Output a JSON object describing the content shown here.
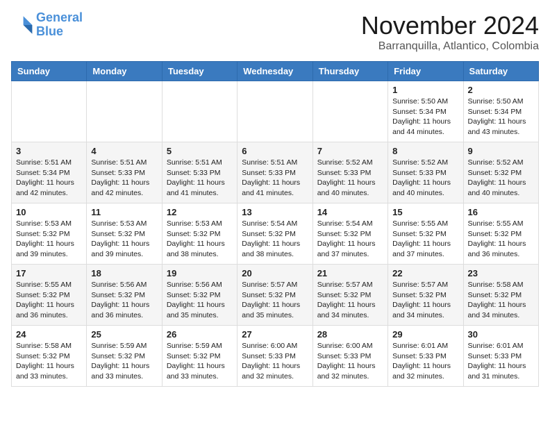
{
  "logo": {
    "line1": "General",
    "line2": "Blue"
  },
  "title": "November 2024",
  "location": "Barranquilla, Atlantico, Colombia",
  "days_of_week": [
    "Sunday",
    "Monday",
    "Tuesday",
    "Wednesday",
    "Thursday",
    "Friday",
    "Saturday"
  ],
  "weeks": [
    [
      {
        "day": "",
        "info": ""
      },
      {
        "day": "",
        "info": ""
      },
      {
        "day": "",
        "info": ""
      },
      {
        "day": "",
        "info": ""
      },
      {
        "day": "",
        "info": ""
      },
      {
        "day": "1",
        "info": "Sunrise: 5:50 AM\nSunset: 5:34 PM\nDaylight: 11 hours\nand 44 minutes."
      },
      {
        "day": "2",
        "info": "Sunrise: 5:50 AM\nSunset: 5:34 PM\nDaylight: 11 hours\nand 43 minutes."
      }
    ],
    [
      {
        "day": "3",
        "info": "Sunrise: 5:51 AM\nSunset: 5:34 PM\nDaylight: 11 hours\nand 42 minutes."
      },
      {
        "day": "4",
        "info": "Sunrise: 5:51 AM\nSunset: 5:33 PM\nDaylight: 11 hours\nand 42 minutes."
      },
      {
        "day": "5",
        "info": "Sunrise: 5:51 AM\nSunset: 5:33 PM\nDaylight: 11 hours\nand 41 minutes."
      },
      {
        "day": "6",
        "info": "Sunrise: 5:51 AM\nSunset: 5:33 PM\nDaylight: 11 hours\nand 41 minutes."
      },
      {
        "day": "7",
        "info": "Sunrise: 5:52 AM\nSunset: 5:33 PM\nDaylight: 11 hours\nand 40 minutes."
      },
      {
        "day": "8",
        "info": "Sunrise: 5:52 AM\nSunset: 5:33 PM\nDaylight: 11 hours\nand 40 minutes."
      },
      {
        "day": "9",
        "info": "Sunrise: 5:52 AM\nSunset: 5:32 PM\nDaylight: 11 hours\nand 40 minutes."
      }
    ],
    [
      {
        "day": "10",
        "info": "Sunrise: 5:53 AM\nSunset: 5:32 PM\nDaylight: 11 hours\nand 39 minutes."
      },
      {
        "day": "11",
        "info": "Sunrise: 5:53 AM\nSunset: 5:32 PM\nDaylight: 11 hours\nand 39 minutes."
      },
      {
        "day": "12",
        "info": "Sunrise: 5:53 AM\nSunset: 5:32 PM\nDaylight: 11 hours\nand 38 minutes."
      },
      {
        "day": "13",
        "info": "Sunrise: 5:54 AM\nSunset: 5:32 PM\nDaylight: 11 hours\nand 38 minutes."
      },
      {
        "day": "14",
        "info": "Sunrise: 5:54 AM\nSunset: 5:32 PM\nDaylight: 11 hours\nand 37 minutes."
      },
      {
        "day": "15",
        "info": "Sunrise: 5:55 AM\nSunset: 5:32 PM\nDaylight: 11 hours\nand 37 minutes."
      },
      {
        "day": "16",
        "info": "Sunrise: 5:55 AM\nSunset: 5:32 PM\nDaylight: 11 hours\nand 36 minutes."
      }
    ],
    [
      {
        "day": "17",
        "info": "Sunrise: 5:55 AM\nSunset: 5:32 PM\nDaylight: 11 hours\nand 36 minutes."
      },
      {
        "day": "18",
        "info": "Sunrise: 5:56 AM\nSunset: 5:32 PM\nDaylight: 11 hours\nand 36 minutes."
      },
      {
        "day": "19",
        "info": "Sunrise: 5:56 AM\nSunset: 5:32 PM\nDaylight: 11 hours\nand 35 minutes."
      },
      {
        "day": "20",
        "info": "Sunrise: 5:57 AM\nSunset: 5:32 PM\nDaylight: 11 hours\nand 35 minutes."
      },
      {
        "day": "21",
        "info": "Sunrise: 5:57 AM\nSunset: 5:32 PM\nDaylight: 11 hours\nand 34 minutes."
      },
      {
        "day": "22",
        "info": "Sunrise: 5:57 AM\nSunset: 5:32 PM\nDaylight: 11 hours\nand 34 minutes."
      },
      {
        "day": "23",
        "info": "Sunrise: 5:58 AM\nSunset: 5:32 PM\nDaylight: 11 hours\nand 34 minutes."
      }
    ],
    [
      {
        "day": "24",
        "info": "Sunrise: 5:58 AM\nSunset: 5:32 PM\nDaylight: 11 hours\nand 33 minutes."
      },
      {
        "day": "25",
        "info": "Sunrise: 5:59 AM\nSunset: 5:32 PM\nDaylight: 11 hours\nand 33 minutes."
      },
      {
        "day": "26",
        "info": "Sunrise: 5:59 AM\nSunset: 5:32 PM\nDaylight: 11 hours\nand 33 minutes."
      },
      {
        "day": "27",
        "info": "Sunrise: 6:00 AM\nSunset: 5:33 PM\nDaylight: 11 hours\nand 32 minutes."
      },
      {
        "day": "28",
        "info": "Sunrise: 6:00 AM\nSunset: 5:33 PM\nDaylight: 11 hours\nand 32 minutes."
      },
      {
        "day": "29",
        "info": "Sunrise: 6:01 AM\nSunset: 5:33 PM\nDaylight: 11 hours\nand 32 minutes."
      },
      {
        "day": "30",
        "info": "Sunrise: 6:01 AM\nSunset: 5:33 PM\nDaylight: 11 hours\nand 31 minutes."
      }
    ]
  ]
}
